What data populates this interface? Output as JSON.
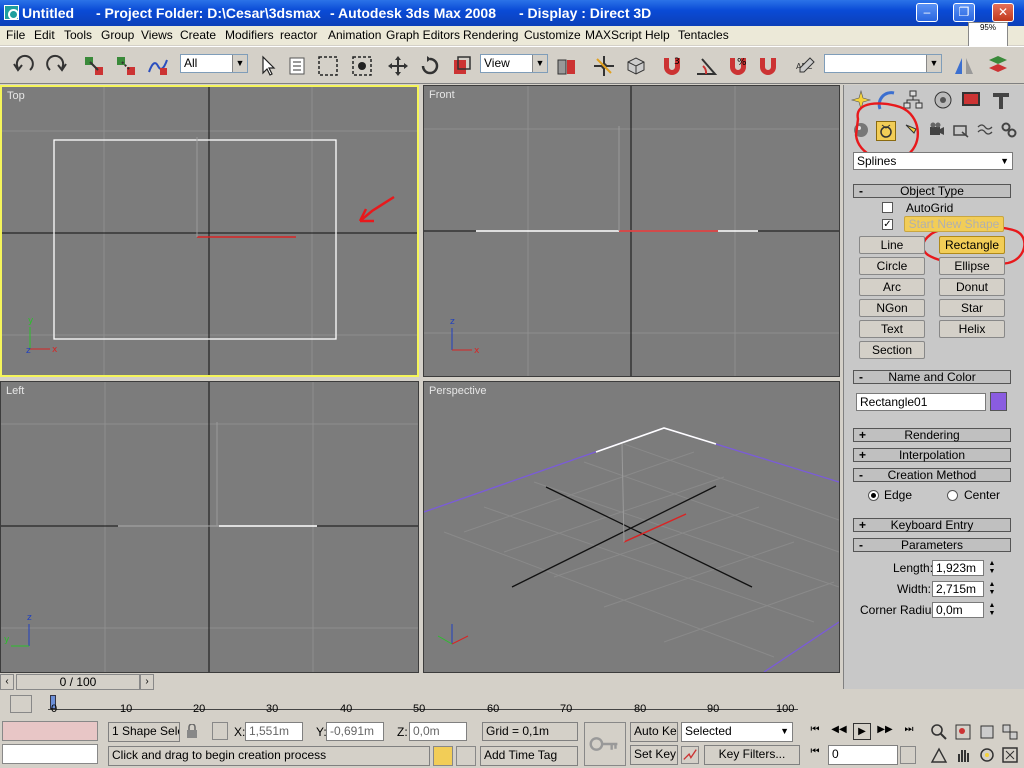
{
  "titlebar": {
    "app": "Untitled",
    "project": "- Project Folder: D:\\Cesar\\3dsmax",
    "product": "- Autodesk 3ds Max 2008",
    "display": "- Display : Direct 3D",
    "minimize": "–",
    "restore": "❐",
    "close": "✕"
  },
  "memmeter": {
    "value": "95%"
  },
  "menu": [
    "File",
    "Edit",
    "Tools",
    "Group",
    "Views",
    "Create",
    "Modifiers",
    "reactor",
    "Animation",
    "Graph Editors",
    "Rendering",
    "Customize",
    "MAXScript",
    "Help",
    "Tentacles"
  ],
  "toolbar": {
    "selection_filter": "All",
    "ref_coord": "View",
    "snap_angle": "3",
    "percent": "%",
    "named_selection": ""
  },
  "viewports": {
    "top": "Top",
    "front": "Front",
    "left": "Left",
    "perspective": "Perspective"
  },
  "cmd": {
    "category": "Splines",
    "object_type": "Object Type",
    "autogrid": "AutoGrid",
    "start_new_shape": "Start New Shape",
    "buttons": [
      "Line",
      "Rectangle",
      "Circle",
      "Ellipse",
      "Arc",
      "Donut",
      "NGon",
      "Star",
      "Text",
      "Helix",
      "Section"
    ],
    "name_and_color": "Name and Color",
    "object_name": "Rectangle01",
    "object_color": "#8a5ce0",
    "rendering": "Rendering",
    "interpolation": "Interpolation",
    "creation_method": "Creation Method",
    "edge": "Edge",
    "center": "Center",
    "keyboard_entry": "Keyboard Entry",
    "parameters": "Parameters",
    "length_label": "Length:",
    "length": "1,923m",
    "width_label": "Width:",
    "width": "2,715m",
    "corner_label": "Corner Radius:",
    "corner": "0,0m"
  },
  "timeline": {
    "frame": "0 / 100",
    "ticks": [
      "0",
      "10",
      "20",
      "30",
      "40",
      "50",
      "60",
      "70",
      "80",
      "90",
      "100"
    ]
  },
  "status": {
    "selection": "1 Shape Sele",
    "x_label": "X:",
    "x": "1,551m",
    "y_label": "Y:",
    "y": "-0,691m",
    "z_label": "Z:",
    "z": "0,0m",
    "grid": "Grid = 0,1m",
    "prompt": "Click and drag to begin creation process",
    "add_time_tag": "Add Time Tag",
    "auto_key": "Auto Key",
    "set_key": "Set Key",
    "key_mode": "Selected",
    "key_filters": "Key Filters...",
    "current_frame": "0"
  },
  "colors": {
    "annotation": "#e8191c",
    "active_viewport": "#f5f55a",
    "active_button": "#f2cd57"
  }
}
